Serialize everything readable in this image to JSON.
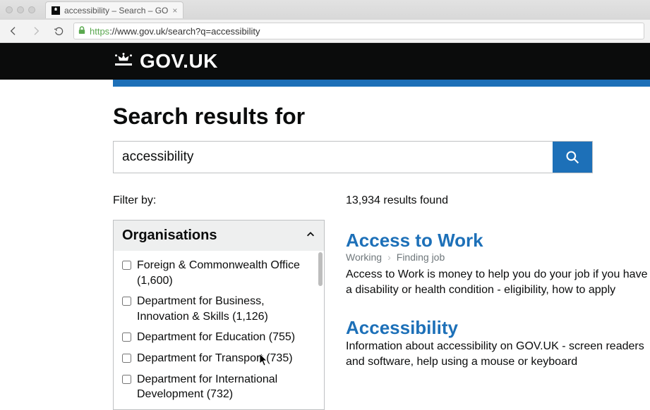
{
  "browser": {
    "tab_title": "accessibility – Search – GO",
    "url_scheme": "https",
    "url_rest": "://www.gov.uk/search?q=accessibility"
  },
  "header": {
    "site_name": "GOV.UK"
  },
  "search": {
    "heading": "Search results for",
    "query": "accessibility"
  },
  "filters": {
    "label": "Filter by:",
    "group_title": "Organisations",
    "items": [
      {
        "label": "Foreign & Commonwealth Office (1,600)"
      },
      {
        "label": "Department for Business, Innovation & Skills (1,126)"
      },
      {
        "label": "Department for Education (755)"
      },
      {
        "label": "Department for Transport (735)"
      },
      {
        "label": "Department for International Development (732)"
      }
    ]
  },
  "results": {
    "count_text": "13,934 results found",
    "items": [
      {
        "title": "Access to Work",
        "breadcrumb": [
          "Working",
          "Finding job"
        ],
        "description": "Access to Work is money to help you do your job if you have a disability or health condition - eligibility, how to apply"
      },
      {
        "title": "Accessibility",
        "breadcrumb": [],
        "description": "Information about accessibility on GOV.UK - screen readers and software, help using a mouse or keyboard"
      }
    ]
  }
}
